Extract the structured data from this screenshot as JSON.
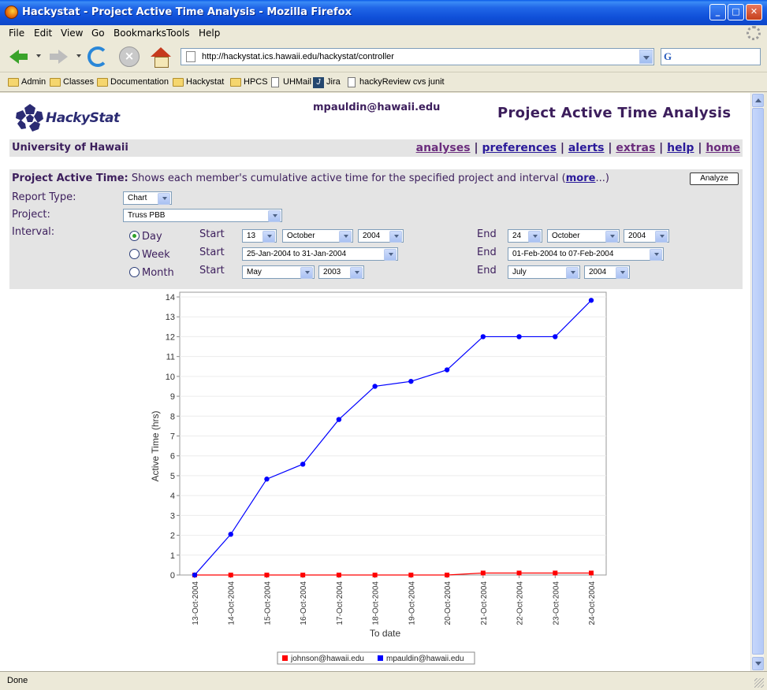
{
  "window": {
    "title": "Hackystat - Project Active Time Analysis - Mozilla Firefox"
  },
  "menu": [
    "File",
    "Edit",
    "View",
    "Go",
    "Bookmarks",
    "Tools",
    "Help"
  ],
  "address": {
    "url": "http://hackystat.ics.hawaii.edu/hackystat/controller",
    "search_engine": "G"
  },
  "bookmarks": [
    {
      "label": "Admin",
      "icon": "folder-icon"
    },
    {
      "label": "Classes",
      "icon": "folder-icon"
    },
    {
      "label": "Documentation",
      "icon": "folder-icon"
    },
    {
      "label": "Hackystat",
      "icon": "folder-icon"
    },
    {
      "label": "HPCS",
      "icon": "folder-icon"
    },
    {
      "label": "UHMail",
      "icon": "page-icon"
    },
    {
      "label": "Jira",
      "icon": "jira-icon"
    },
    {
      "label": "hackyReview cvs junit",
      "icon": "page-icon"
    }
  ],
  "header": {
    "logo_text": "HackyStat",
    "user_email": "mpauldin@hawaii.edu",
    "page_title": "Project Active Time Analysis",
    "org": "University of Hawaii",
    "links": [
      "analyses",
      "preferences",
      "alerts",
      "extras",
      "help",
      "home"
    ],
    "separator": "|"
  },
  "form": {
    "heading": "Project Active Time:",
    "description": "Shows each member's cumulative active time for the specified project and interval (",
    "more_link": "more",
    "description_end": "...)",
    "analyze_button": "Analyze",
    "report_type_label": "Report Type:",
    "report_type_value": "Chart",
    "project_label": "Project:",
    "project_value": "Truss PBB",
    "interval_label": "Interval:",
    "start_label": "Start",
    "end_label": "End",
    "rows": [
      {
        "label": "Day",
        "checked": true,
        "start": [
          "13",
          "October",
          "2004"
        ],
        "end": [
          "24",
          "October",
          "2004"
        ]
      },
      {
        "label": "Week",
        "checked": false,
        "start": [
          "25-Jan-2004 to 31-Jan-2004"
        ],
        "end": [
          "01-Feb-2004 to 07-Feb-2004"
        ]
      },
      {
        "label": "Month",
        "checked": false,
        "start": [
          "May",
          "2003"
        ],
        "end": [
          "July",
          "2004"
        ]
      }
    ]
  },
  "chart_data": {
    "type": "line",
    "xlabel": "To date",
    "ylabel": "Active Time (hrs)",
    "ylim": [
      0,
      14
    ],
    "yticks": [
      0,
      1,
      2,
      3,
      4,
      5,
      6,
      7,
      8,
      9,
      10,
      11,
      12,
      13,
      14
    ],
    "categories": [
      "13-Oct-2004",
      "14-Oct-2004",
      "15-Oct-2004",
      "16-Oct-2004",
      "17-Oct-2004",
      "18-Oct-2004",
      "19-Oct-2004",
      "20-Oct-2004",
      "21-Oct-2004",
      "22-Oct-2004",
      "23-Oct-2004",
      "24-Oct-2004"
    ],
    "series": [
      {
        "name": "johnson@hawaii.edu",
        "color": "#ff0000",
        "marker": "square",
        "values": [
          0,
          0,
          0,
          0,
          0,
          0,
          0,
          0,
          0.1,
          0.1,
          0.1,
          0.1
        ]
      },
      {
        "name": "mpauldin@hawaii.edu",
        "color": "#0000ff",
        "marker": "circle",
        "values": [
          0,
          2.05,
          4.83,
          5.58,
          7.83,
          9.5,
          9.75,
          10.33,
          12.0,
          12.0,
          12.0,
          13.83
        ]
      }
    ],
    "legend": "bottom",
    "grid": true
  },
  "status": {
    "text": "Done"
  }
}
